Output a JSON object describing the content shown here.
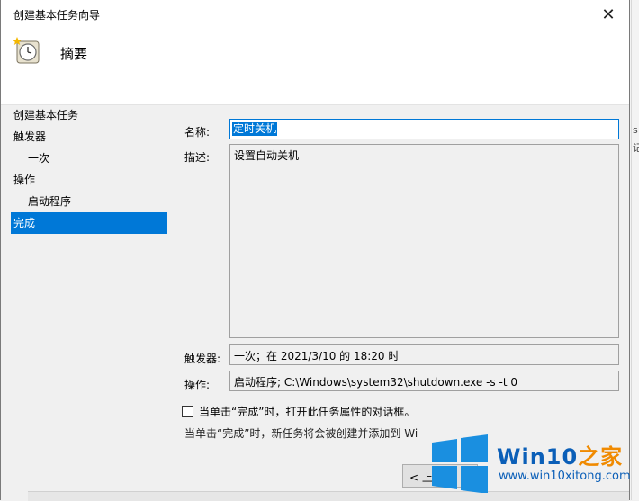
{
  "window": {
    "title": "创建基本任务向导",
    "close_glyph": "✕"
  },
  "header": {
    "title": "摘要",
    "icon": "scheduled-task-clock-icon"
  },
  "steps": [
    {
      "label": "创建基本任务"
    },
    {
      "label": "触发器"
    },
    {
      "label": "一次"
    },
    {
      "label": "操作"
    },
    {
      "label": "启动程序"
    },
    {
      "label": "完成"
    }
  ],
  "form": {
    "name_label": "名称:",
    "name_value": "定时关机",
    "desc_label": "描述:",
    "desc_value": "设置自动关机",
    "trigger_label": "触发器:",
    "trigger_value": "一次；在 2021/3/10 的 18:20 时",
    "action_label": "操作:",
    "action_value": "启动程序; C:\\Windows\\system32\\shutdown.exe -s -t 0"
  },
  "checkbox": {
    "label": "当单击“完成”时，打开此任务属性的对话框。",
    "checked": false
  },
  "info": {
    "text": "当单击“完成”时，新任务将会被创建并添加到 Wi"
  },
  "buttons": {
    "back_label": "< 上"
  },
  "background_fragments": [
    "s",
    "记"
  ],
  "watermark": {
    "brand_main": "Win10",
    "brand_accent": "之家",
    "url": "www.win10xitong.com"
  },
  "colors": {
    "accent": "#0078d7",
    "watermark_blue": "#0b5fb8",
    "watermark_orange": "#f08a00"
  }
}
